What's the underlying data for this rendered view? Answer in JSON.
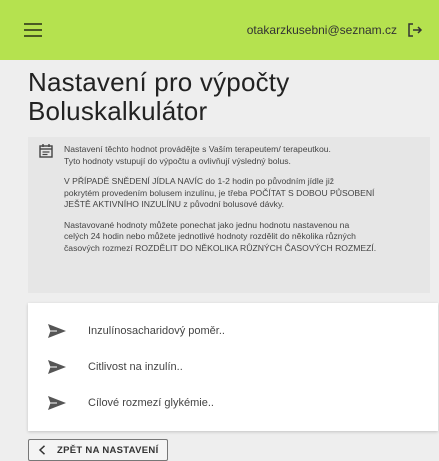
{
  "header": {
    "user_email": "otakarzkusebni@seznam.cz",
    "accent_color": "#b5e24f"
  },
  "page": {
    "title_line1": "Nastavení pro výpočty",
    "title_line2": "Boluskalkulátor"
  },
  "info": {
    "icon": "calendar-note-icon",
    "paragraph1_line1": "Nastavení těchto hodnot provádějte s Vaším terapeutem/ terapeutkou.",
    "paragraph1_line2": "Tyto hodnoty vstupují do výpočtu a ovlivňují výsledný bolus.",
    "paragraph2_line1": "V PŘÍPADĚ SNĚDENÍ JÍDLA NAVÍC do 1-2 hodin po původním jídle již",
    "paragraph2_line2": "pokrytém provedením bolusem inzulínu, je třeba POČÍTAT S DOBOU PŮSOBENÍ",
    "paragraph2_line3": "JEŠTĚ AKTIVNÍHO INZULÍNU z původní bolusové dávky.",
    "paragraph3_line1": "Nastavované hodnoty můžete ponechat jako jednu hodnotu nastavenou na",
    "paragraph3_line2": "celých 24 hodin nebo můžete jednotlivé hodnoty rozdělit do několika různých",
    "paragraph3_line3": "časových rozmezí ROZDĚLIT DO NĚKOLIKA RŮZNÝCH ČASOVÝCH ROZMEZÍ."
  },
  "settings_list": {
    "items": [
      {
        "label": "Inzulínosacharidový poměr..",
        "icon": "send-icon"
      },
      {
        "label": "Citlivost na inzulín..",
        "icon": "send-icon"
      },
      {
        "label": "Cílové rozmezí glykémie..",
        "icon": "send-icon"
      }
    ]
  },
  "footer": {
    "back_label": "ZPĚT NA NASTAVENÍ"
  }
}
